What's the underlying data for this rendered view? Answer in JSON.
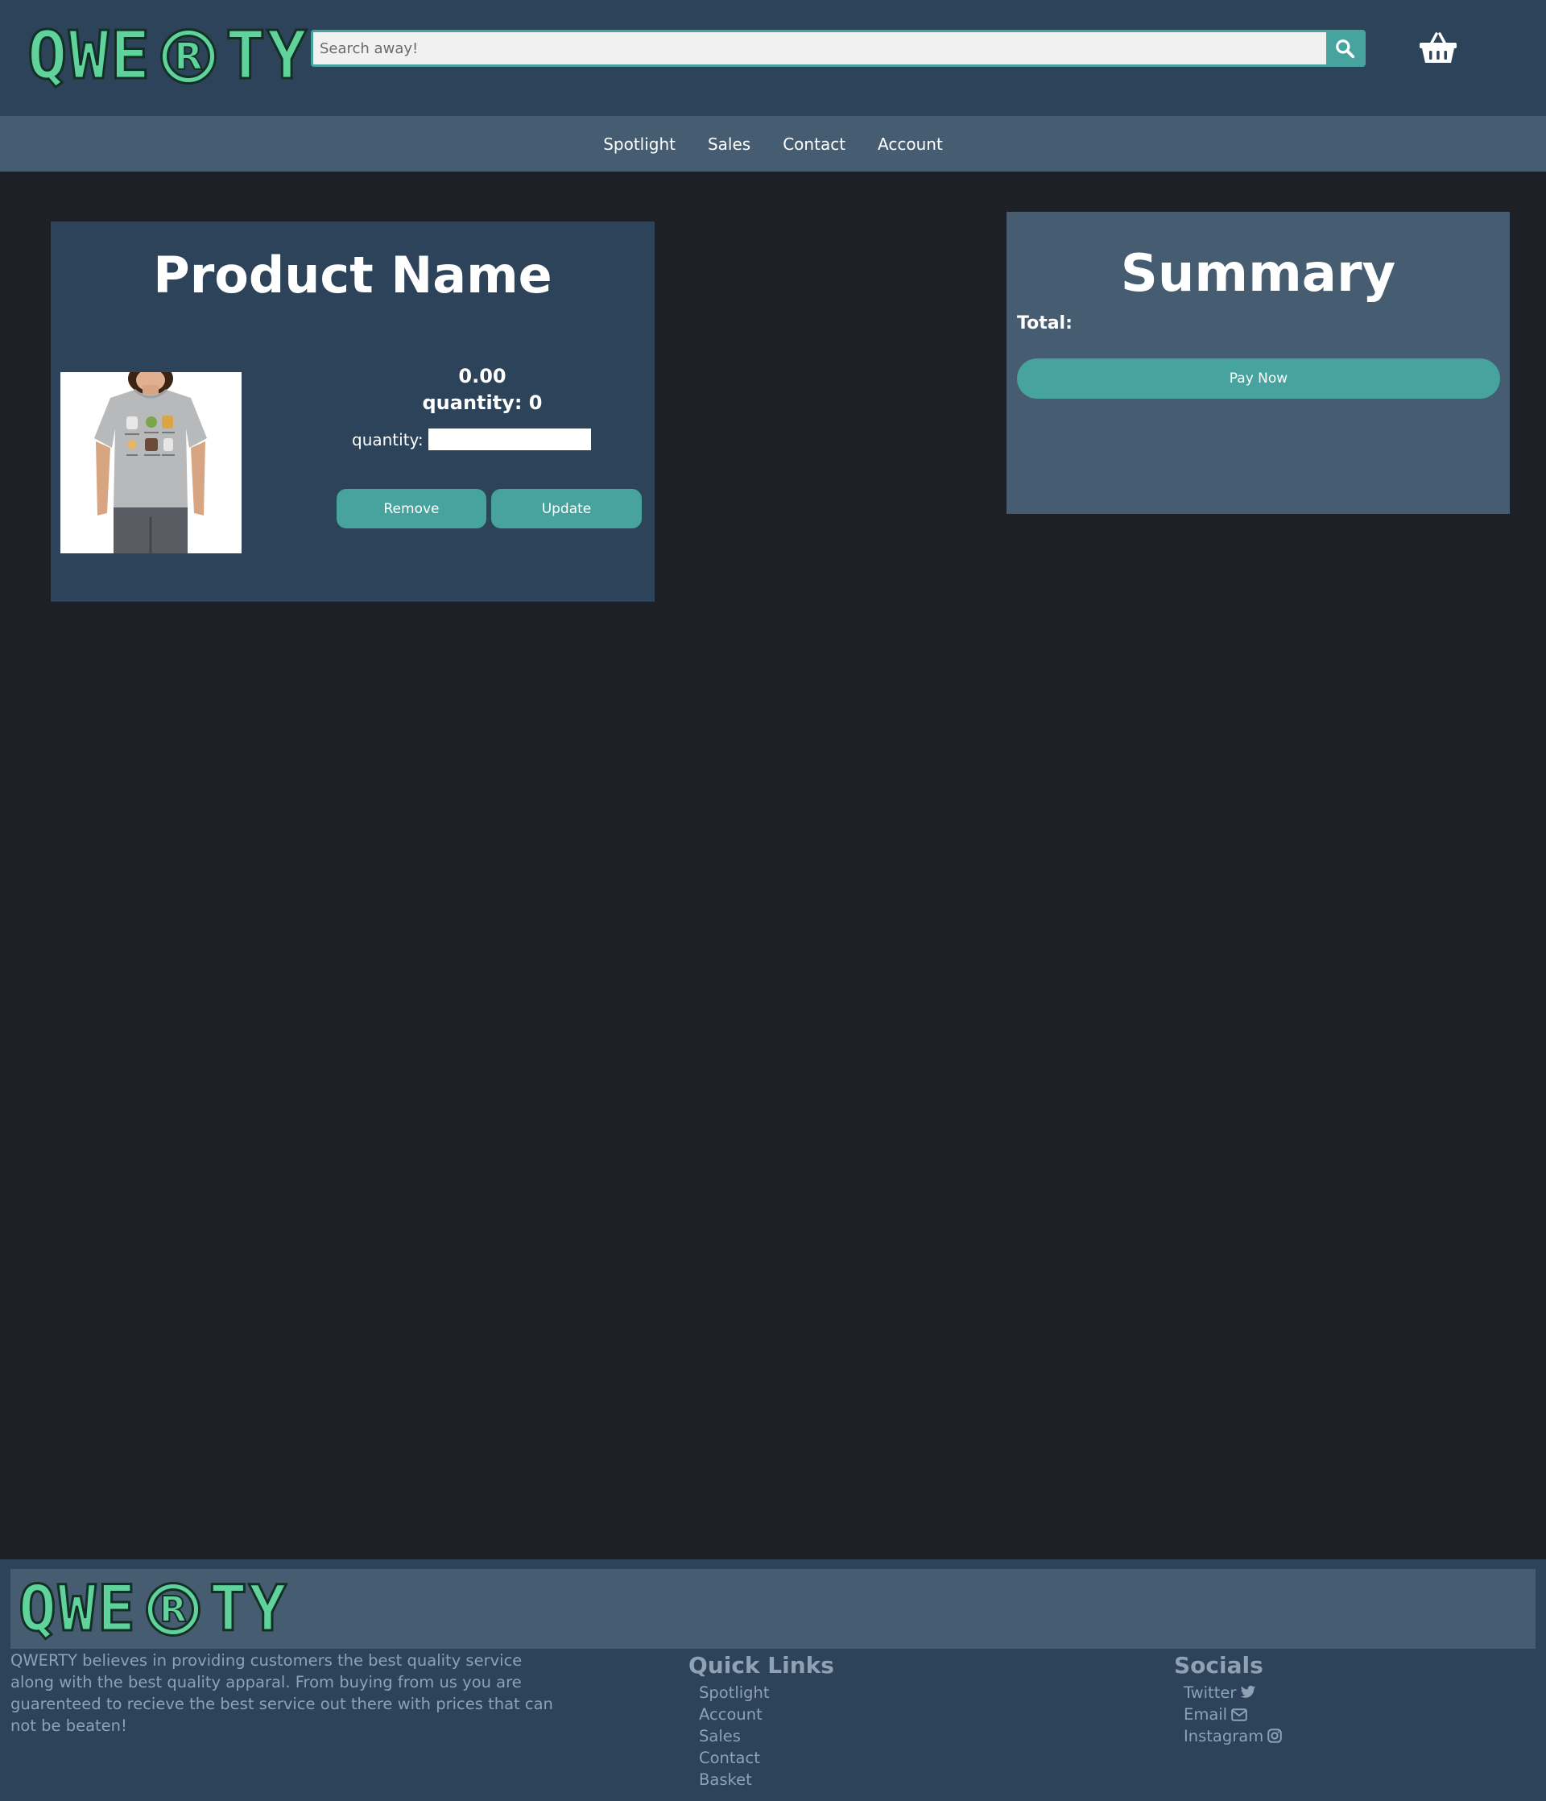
{
  "brand": {
    "letters_left": [
      "Q",
      "W",
      "E"
    ],
    "registered_mark": "R",
    "letters_right": [
      "T",
      "Y"
    ],
    "accent_color": "#5fd39b",
    "teal": "#46a39d"
  },
  "search": {
    "placeholder": "Search away!",
    "value": "",
    "icon": "search-icon"
  },
  "header": {
    "basket_icon": "basket-icon"
  },
  "nav": {
    "items": [
      {
        "label": "Spotlight"
      },
      {
        "label": "Sales"
      },
      {
        "label": "Contact"
      },
      {
        "label": "Account"
      }
    ]
  },
  "product": {
    "name": "Product Name",
    "price": "0.00",
    "quantity_text": "quantity: 0",
    "quantity_label": "quantity:",
    "quantity_value": "",
    "remove_label": "Remove",
    "update_label": "Update"
  },
  "summary": {
    "title": "Summary",
    "total_label": "Total:",
    "pay_label": "Pay Now"
  },
  "footer": {
    "about": "QWERTY believes in providing customers the best quality service along with the best quality apparal. From buying from us you are guarenteed to recieve the best service out there with prices that can not be beaten!",
    "quick_links": {
      "title": "Quick Links",
      "items": [
        {
          "label": "Spotlight"
        },
        {
          "label": "Account"
        },
        {
          "label": "Sales"
        },
        {
          "label": "Contact"
        },
        {
          "label": "Basket"
        }
      ]
    },
    "socials": {
      "title": "Socials",
      "items": [
        {
          "label": "Twitter",
          "icon": "twitter-icon"
        },
        {
          "label": "Email",
          "icon": "envelope-icon"
        },
        {
          "label": "Instagram",
          "icon": "instagram-icon"
        }
      ]
    }
  }
}
